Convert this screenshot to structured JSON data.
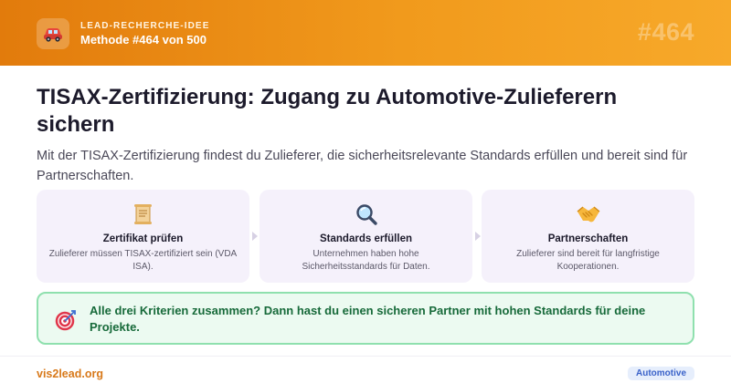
{
  "header": {
    "kicker": "LEAD-RECHERCHE-IDEE",
    "method": "Methode #464 von 500",
    "number": "#464",
    "logo_icon": "car-icon"
  },
  "main": {
    "title": "TISAX-Zertifizierung: Zugang zu Automotive-Zulieferern sichern",
    "intro": "Mit der TISAX-Zertifizierung findest du Zulieferer, die sicherheitsrelevante Standards erfüllen und bereit sind für Partnerschaften."
  },
  "steps": [
    {
      "icon": "scroll-icon",
      "title": "Zertifikat prüfen",
      "description": "Zulieferer müssen TISAX-zertifiziert sein (VDA ISA)."
    },
    {
      "icon": "magnifier-icon",
      "title": "Standards erfüllen",
      "description": "Unternehmen haben hohe Sicherheitsstandards für Daten."
    },
    {
      "icon": "handshake-icon",
      "title": "Partnerschaften",
      "description": "Zulieferer sind bereit für langfristige Kooperationen."
    }
  ],
  "callout": {
    "icon": "target-icon",
    "text": "Alle drei Kriterien zusammen? Dann hast du einen sicheren Partner mit hohen Standards für deine Projekte."
  },
  "footer": {
    "brand": "vis2lead.org",
    "tag": "Automotive"
  },
  "colors": {
    "header_start": "#e27b0c",
    "header_end": "#f7a92a",
    "card_bg": "#f5f1fb",
    "callout_bg": "#ecfaf1",
    "callout_border": "#8fe0ae",
    "callout_text": "#176a3a",
    "brand": "#d8791a",
    "tag_bg": "#e6eefc",
    "tag_text": "#3a62c9"
  }
}
